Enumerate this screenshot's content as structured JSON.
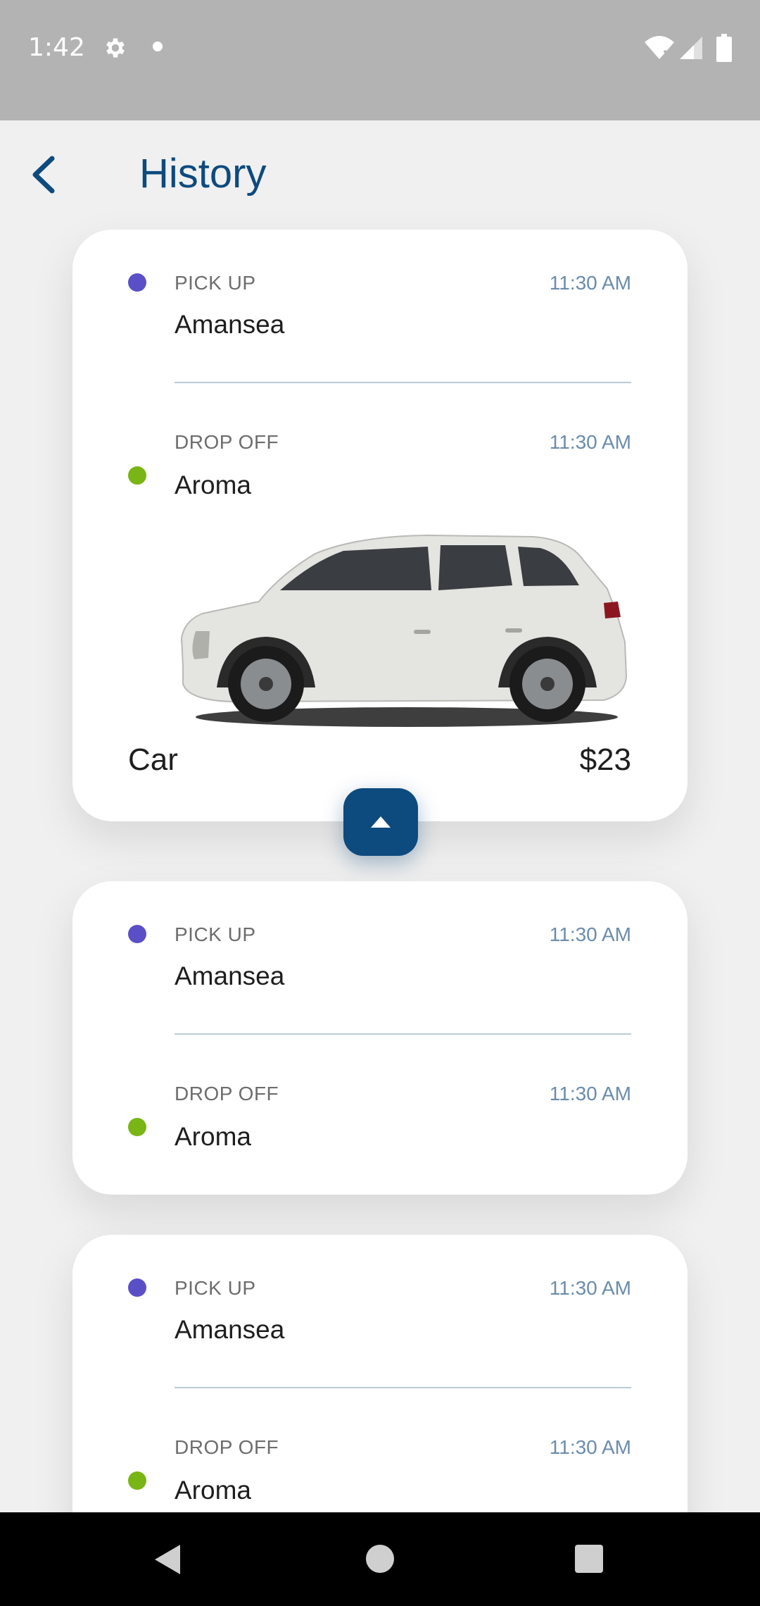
{
  "status_bar": {
    "time": "1:42",
    "icons": [
      "gear-icon",
      "notification-dot-icon",
      "wifi-off-icon",
      "cell-signal-icon",
      "battery-icon"
    ]
  },
  "header": {
    "title": "History",
    "back_icon": "chevron-left-icon"
  },
  "colors": {
    "accent": "#0d4a7e",
    "pickup_dot": "#5b4fc7",
    "dropoff_dot": "#79b514",
    "time_text": "#6a8cab"
  },
  "trips": [
    {
      "pickup": {
        "label": "PICK UP",
        "time": "11:30 AM",
        "place": "Amansea"
      },
      "dropoff": {
        "label": "DROP OFF",
        "time": "11:30 AM",
        "place": "Aroma"
      },
      "vehicle": "Car",
      "fare": "$23",
      "expanded": true
    },
    {
      "pickup": {
        "label": "PICK UP",
        "time": "11:30 AM",
        "place": "Amansea"
      },
      "dropoff": {
        "label": "DROP OFF",
        "time": "11:30 AM",
        "place": "Aroma"
      },
      "expanded": false
    },
    {
      "pickup": {
        "label": "PICK UP",
        "time": "11:30 AM",
        "place": "Amansea"
      },
      "dropoff": {
        "label": "DROP OFF",
        "time": "11:30 AM",
        "place": "Aroma"
      },
      "expanded": false
    }
  ],
  "collapse_icon": "triangle-up-icon",
  "nav_bar": {
    "icons": [
      "nav-back-icon",
      "nav-home-icon",
      "nav-recents-icon"
    ]
  }
}
